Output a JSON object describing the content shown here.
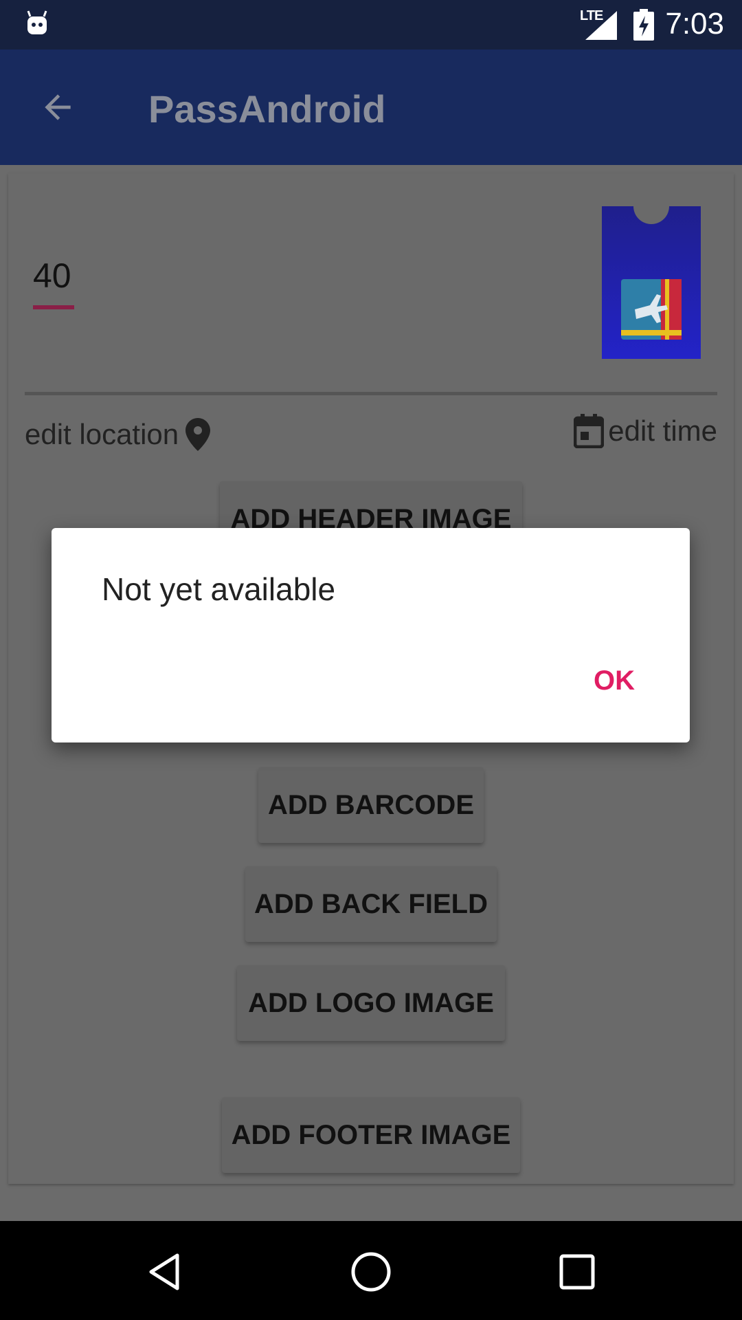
{
  "status_bar": {
    "time": "7:03",
    "network": "LTE",
    "icons": [
      "android-app-icon",
      "signal-icon",
      "battery-charging-icon"
    ]
  },
  "app_bar": {
    "title": "PassAndroid",
    "back_icon": "arrow-back-icon"
  },
  "pass_editor": {
    "value": "40",
    "edit_location_label": "edit location",
    "edit_time_label": "edit time",
    "buttons": {
      "add_header_image": "ADD HEADER IMAGE",
      "add_barcode": "ADD BARCODE",
      "add_back_field": "ADD BACK FIELD",
      "add_logo_image": "ADD LOGO IMAGE",
      "add_footer_image": "ADD FOOTER IMAGE"
    }
  },
  "dialog": {
    "message": "Not yet available",
    "ok_label": "OK"
  },
  "nav_bar": {
    "icons": [
      "back-triangle-icon",
      "home-circle-icon",
      "recents-square-icon"
    ]
  },
  "colors": {
    "accent": "#e01d63",
    "app_bar": "#182a5e",
    "status_bar": "#16213f"
  }
}
